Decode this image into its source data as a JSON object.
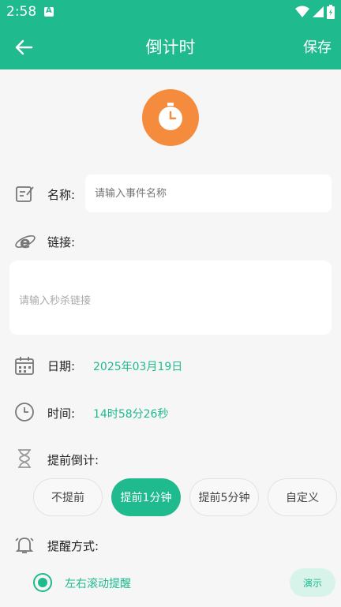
{
  "status": {
    "time": "2:58",
    "notif_glyph": "A"
  },
  "appbar": {
    "title": "倒计时",
    "save_label": "保存"
  },
  "form": {
    "name_label": "名称:",
    "name_placeholder": "请输入事件名称",
    "link_label": "链接:",
    "link_placeholder": "请输入秒杀链接",
    "date_label": "日期:",
    "date_value": "2025年03月19日",
    "time_label": "时间:",
    "time_value": "14时58分26秒",
    "advance_label": "提前倒计:",
    "advance_options": [
      "不提前",
      "提前1分钟",
      "提前5分钟",
      "自定义"
    ],
    "advance_selected": "提前1分钟",
    "remind_label": "提醒方式:",
    "remind_option": "左右滚动提醒",
    "demo_label": "演示"
  },
  "colors": {
    "accent": "#1fba8e",
    "clock": "#f58c3d"
  }
}
